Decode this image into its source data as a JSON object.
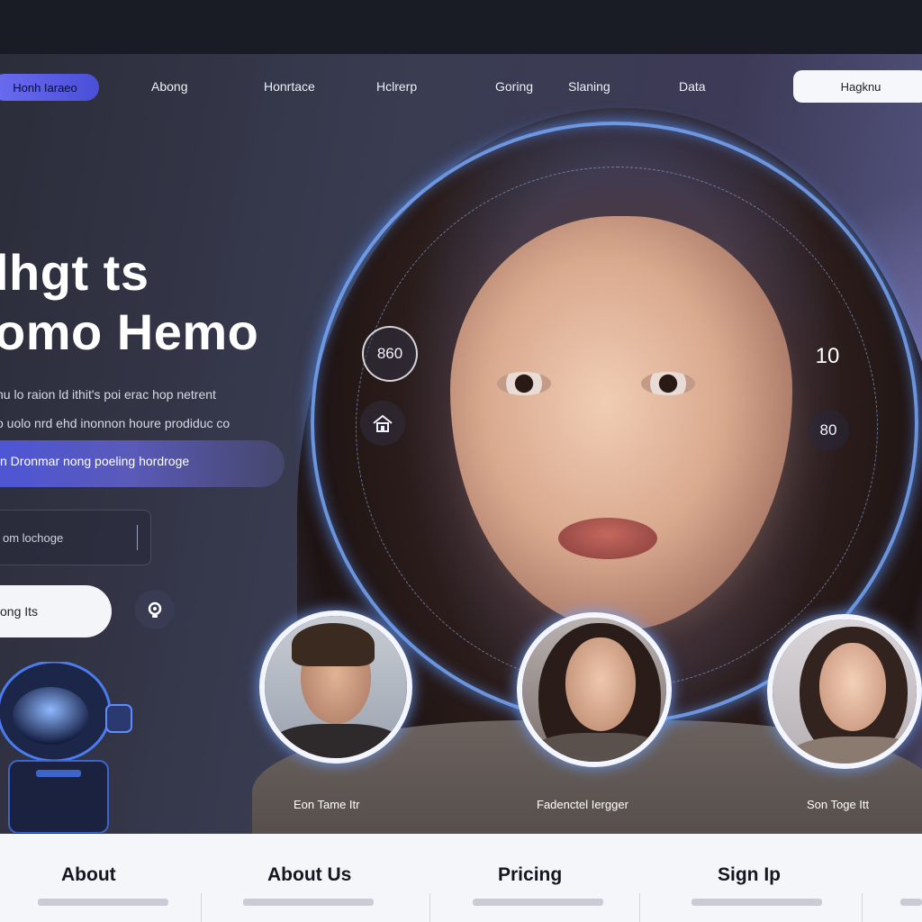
{
  "nav": {
    "brand_button": "Honh Iaraeo",
    "links": [
      "Abong",
      "Honrtace",
      "Hclrerp",
      "Goring",
      "Slaning",
      "Data"
    ],
    "login_button": "Hagknu"
  },
  "hero": {
    "headline_1": "lhgt ts",
    "headline_2": "omo Hemo",
    "desc_1": "hu lo raion ld ithit's poi erac hop netrent",
    "desc_2": "o uolo nrd ehd inonnon houre prodiduc co",
    "cta_label": "n Dronmar nong poeling hordroge",
    "search_text": "om lochoge",
    "pill_label": "ong Its",
    "badge_left": "860",
    "badge_right": "10",
    "badge_right_2": "80"
  },
  "profiles": [
    {
      "caption": "Eon Tame Itr"
    },
    {
      "caption": "Fadenctel Iergger"
    },
    {
      "caption": "Son Toge Itt"
    }
  ],
  "footer": {
    "columns": [
      "About",
      "About Us",
      "Pricing",
      "Sign Ip"
    ]
  },
  "colors": {
    "accent": "#5a5ff0",
    "ring_glow": "#78aaff",
    "footer_bg": "#f5f6fa"
  }
}
